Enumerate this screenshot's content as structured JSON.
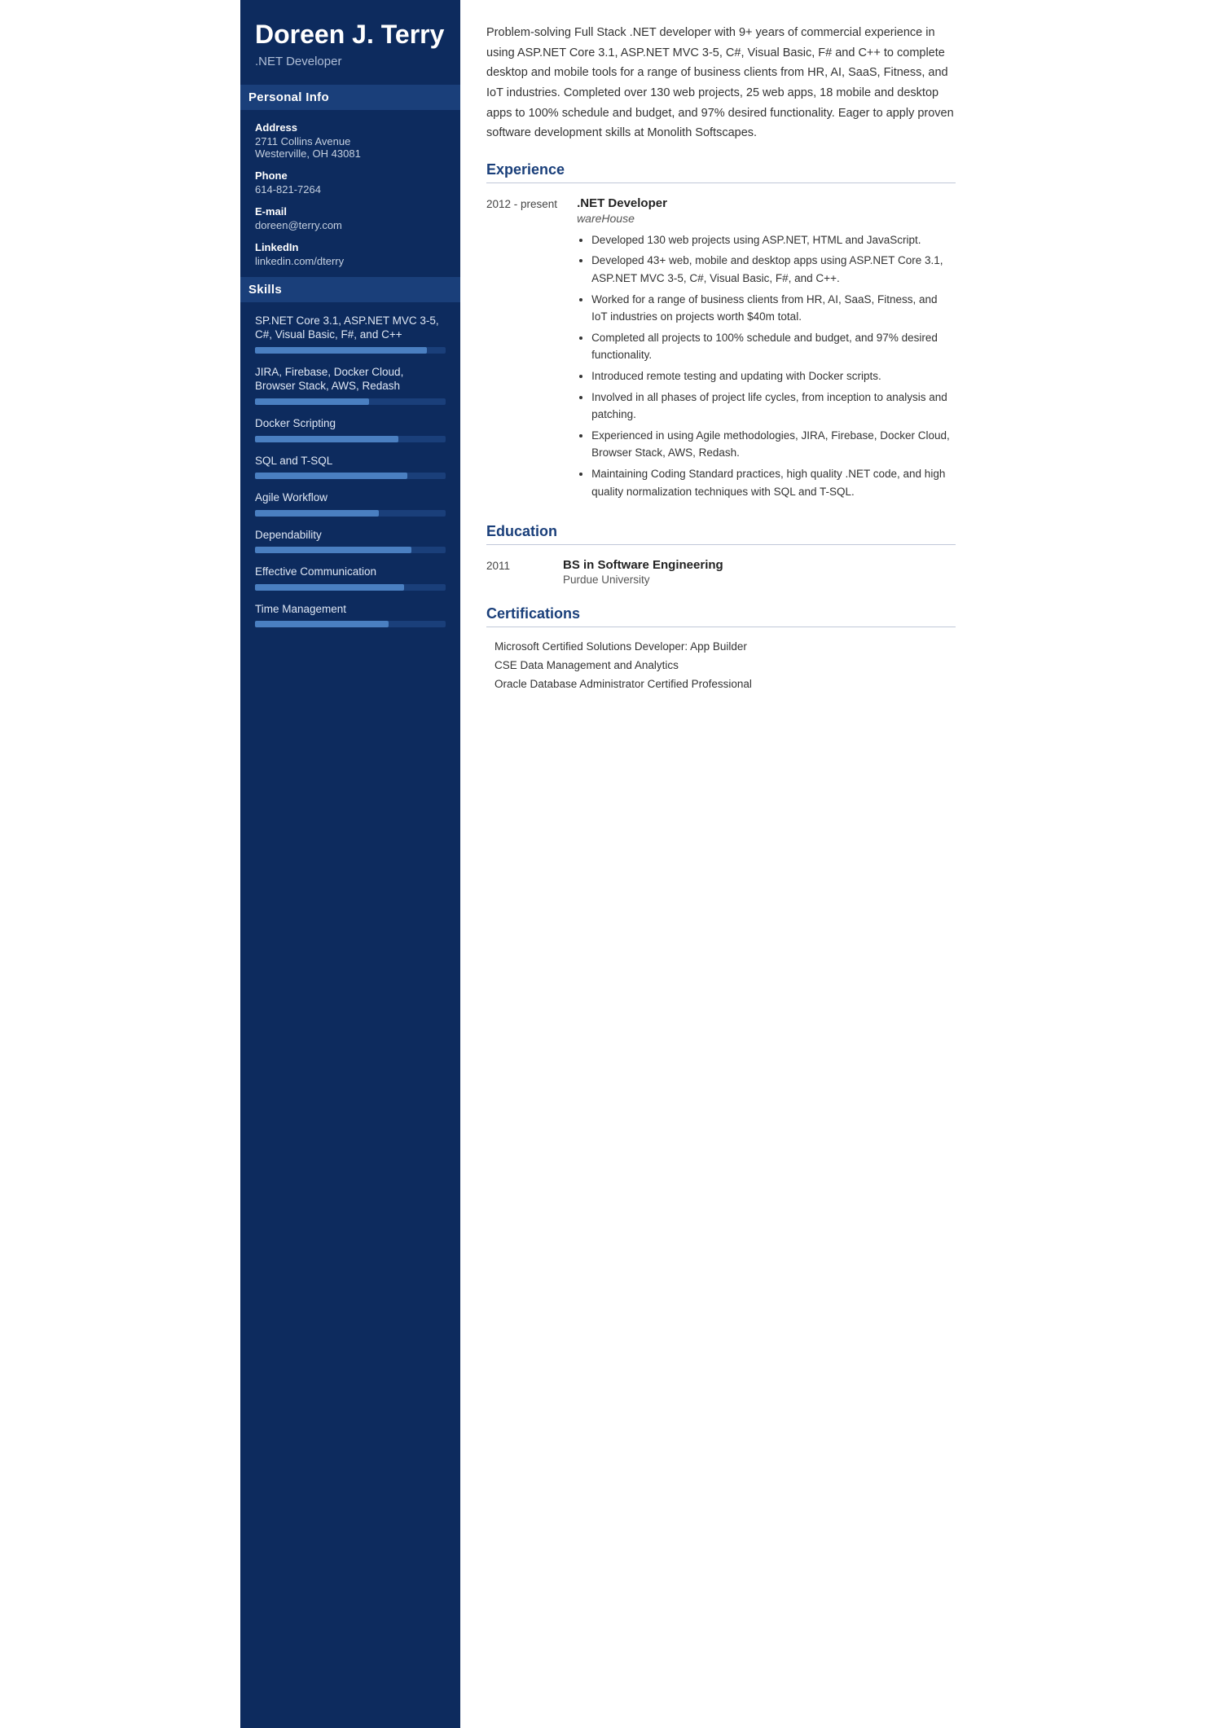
{
  "sidebar": {
    "name": "Doreen J. Terry",
    "title": ".NET Developer",
    "personal_info_label": "Personal Info",
    "address_label": "Address",
    "address_line1": "2711 Collins Avenue",
    "address_line2": "Westerville, OH 43081",
    "phone_label": "Phone",
    "phone_value": "614-821-7264",
    "email_label": "E-mail",
    "email_value": "doreen@terry.com",
    "linkedin_label": "LinkedIn",
    "linkedin_value": "linkedin.com/dterry",
    "skills_label": "Skills",
    "skills": [
      {
        "name": "SP.NET Core 3.1, ASP.NET MVC 3-5, C#, Visual Basic, F#, and C++",
        "pct": 90
      },
      {
        "name": "JIRA, Firebase, Docker Cloud, Browser Stack, AWS, Redash",
        "pct": 60
      },
      {
        "name": "Docker Scripting",
        "pct": 75
      },
      {
        "name": "SQL and T-SQL",
        "pct": 80
      },
      {
        "name": "Agile Workflow",
        "pct": 65
      },
      {
        "name": "Dependability",
        "pct": 82
      },
      {
        "name": "Effective Communication",
        "pct": 78
      },
      {
        "name": "Time Management",
        "pct": 70
      }
    ]
  },
  "main": {
    "summary": "Problem-solving Full Stack .NET developer with 9+ years of commercial experience in using ASP.NET Core 3.1, ASP.NET MVC 3-5, C#, Visual Basic, F# and C++ to complete desktop and mobile tools for a range of business clients from HR, AI, SaaS, Fitness, and IoT industries. Completed over 130 web projects, 25 web apps, 18 mobile and desktop apps to 100% schedule and budget, and 97% desired functionality. Eager to apply proven software development skills at Monolith Softscapes.",
    "experience_label": "Experience",
    "experience": [
      {
        "date": "2012 - present",
        "title": ".NET Developer",
        "company": "wareHouse",
        "bullets": [
          "Developed 130 web projects using ASP.NET, HTML and JavaScript.",
          "Developed 43+ web, mobile and desktop apps using ASP.NET Core 3.1, ASP.NET MVC 3-5, C#, Visual Basic, F#, and C++.",
          "Worked for a range of business clients from HR, AI, SaaS, Fitness, and IoT industries on projects worth $40m total.",
          "Completed all projects to 100% schedule and budget, and 97% desired functionality.",
          "Introduced remote testing and updating with Docker scripts.",
          "Involved in all phases of project life cycles, from inception to analysis and patching.",
          "Experienced in using Agile methodologies, JIRA, Firebase, Docker Cloud, Browser Stack, AWS, Redash.",
          "Maintaining Coding Standard practices, high quality .NET code, and high quality normalization techniques with SQL and T-SQL."
        ]
      }
    ],
    "education_label": "Education",
    "education": [
      {
        "date": "2011",
        "degree": "BS in Software Engineering",
        "school": "Purdue University"
      }
    ],
    "certifications_label": "Certifications",
    "certifications": [
      "Microsoft Certified Solutions Developer: App Builder",
      "CSE Data Management and Analytics",
      "Oracle Database Administrator Certified Professional"
    ]
  }
}
